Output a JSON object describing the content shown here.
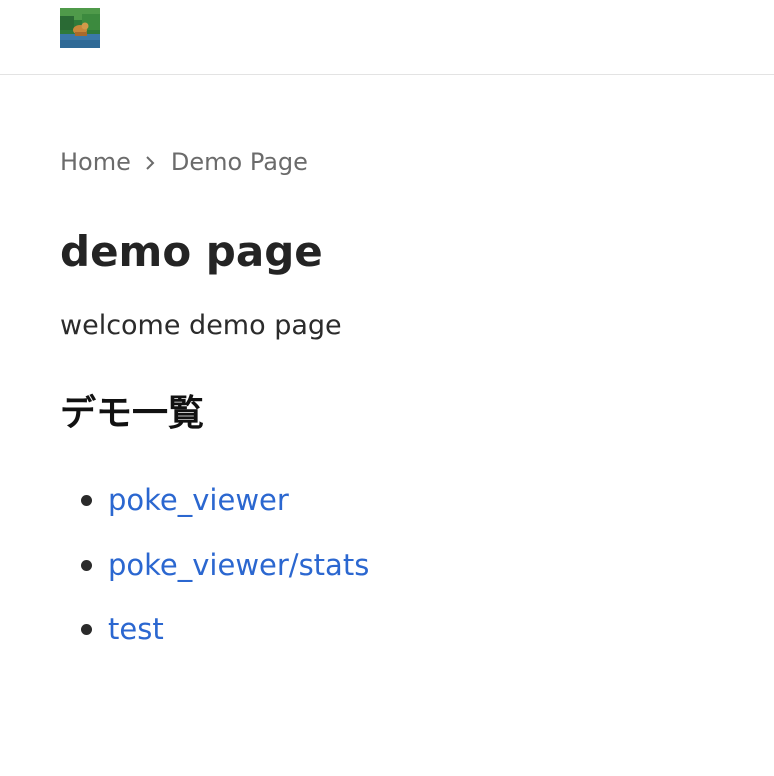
{
  "header": {
    "logo_icon": "forest-animal-logo"
  },
  "breadcrumb": {
    "home": "Home",
    "current": "Demo Page"
  },
  "page": {
    "title": "demo page",
    "intro": "welcome demo page",
    "section_heading": "デモ一覧"
  },
  "demos": [
    {
      "label": "poke_viewer"
    },
    {
      "label": "poke_viewer/stats"
    },
    {
      "label": "test"
    }
  ],
  "colors": {
    "link": "#2b67d0",
    "breadcrumb": "#6b6b6b",
    "divider": "#e3e3e3"
  }
}
